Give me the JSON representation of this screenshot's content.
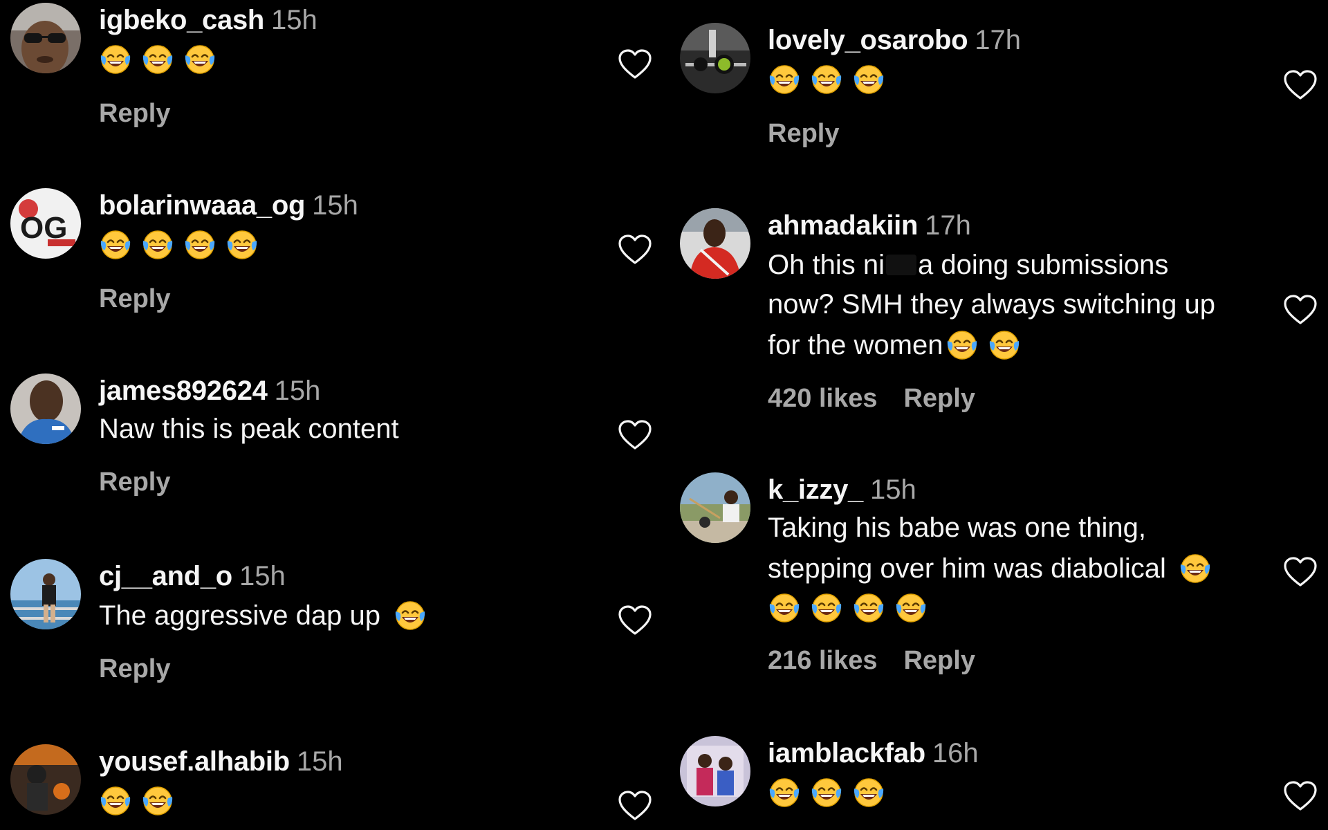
{
  "colors": {
    "background": "#000000",
    "text_primary": "#f5f5f5",
    "text_secondary": "#a8a8a8"
  },
  "comments_left": [
    {
      "username": "igbeko_cash",
      "time": "15h",
      "text": "",
      "emojis": 3,
      "likes": "",
      "reply": "Reply"
    },
    {
      "username": "bolarinwaaa_og",
      "time": "15h",
      "text": "",
      "emojis": 4,
      "likes": "",
      "reply": "Reply"
    },
    {
      "username": "james892624",
      "time": "15h",
      "text": "Naw this is peak content",
      "emojis": 0,
      "likes": "",
      "reply": "Reply"
    },
    {
      "username": "cj__and_o",
      "time": "15h",
      "text": "The aggressive dap up",
      "emojis": 0,
      "likes": "",
      "reply": "Reply"
    },
    {
      "username": "yousef.alhabib",
      "time": "15h",
      "text": "",
      "emojis": 2,
      "likes": "",
      "reply": ""
    }
  ],
  "comments_right": [
    {
      "username": "lovely_osarobo",
      "time": "17h",
      "text": "",
      "emojis": 3,
      "likes": "",
      "reply": "Reply"
    },
    {
      "username": "ahmadakiin",
      "time": "17h",
      "text_lines": [
        "Oh this ni",
        "a doing submissions",
        "now? SMH they always switching up",
        "for the women"
      ],
      "likes": "420 likes",
      "reply": "Reply"
    },
    {
      "username": "k_izzy_",
      "time": "15h",
      "text_lines": [
        "Taking his babe was one thing,",
        "stepping over him was diabolical"
      ],
      "emojis": 4,
      "likes": "216 likes",
      "reply": "Reply"
    },
    {
      "username": "iamblackfab",
      "time": "16h",
      "text": "",
      "emojis": 3,
      "likes": "",
      "reply": ""
    }
  ],
  "icons": {
    "emoji": "face-with-tears-of-joy-icon",
    "like": "heart-outline-icon"
  }
}
